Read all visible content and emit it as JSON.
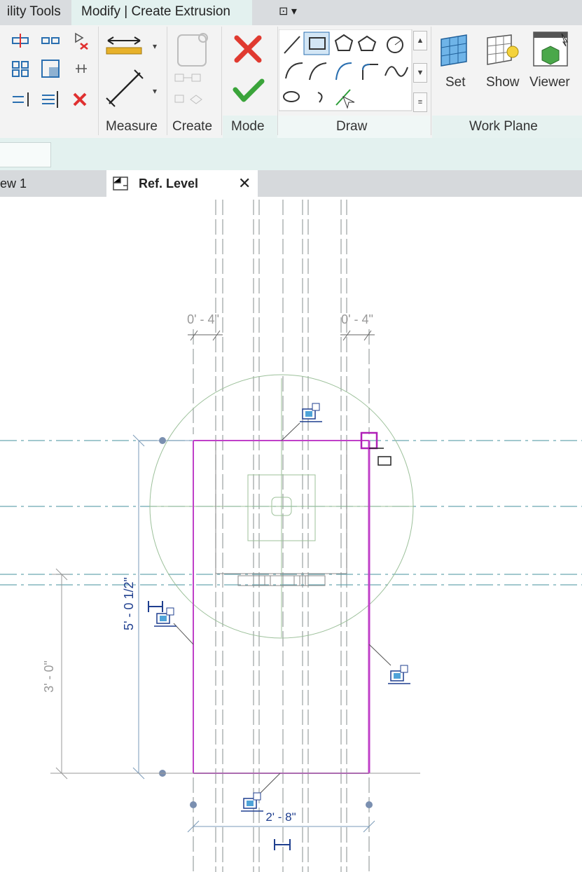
{
  "tabs": {
    "utility": "ility Tools",
    "modify": "Modify | Create Extrusion",
    "quick": "⊡ ▾"
  },
  "ribbon": {
    "panels": {
      "measure": "Measure",
      "create": "Create",
      "mode": "Mode",
      "draw": "Draw",
      "workplane": "Work Plane"
    },
    "buttons": {
      "set": "Set",
      "show": "Show",
      "viewer": "Viewer"
    }
  },
  "view_tabs": {
    "prev": "ew 1",
    "active": "Ref. Level",
    "close": "✕"
  },
  "dimensions": {
    "offset_left": "0' - 4\"",
    "offset_right": "0' - 4\"",
    "height_total": "5' - 0 1/2\"",
    "height_lower": "3' - 0\"",
    "width": "2' - 8\""
  },
  "colors": {
    "sketch": "#c040c8",
    "dimension": "#1f3f8f",
    "ref_plane": "#6aa6b0",
    "ribbon_accent": "#e3f1ef"
  }
}
